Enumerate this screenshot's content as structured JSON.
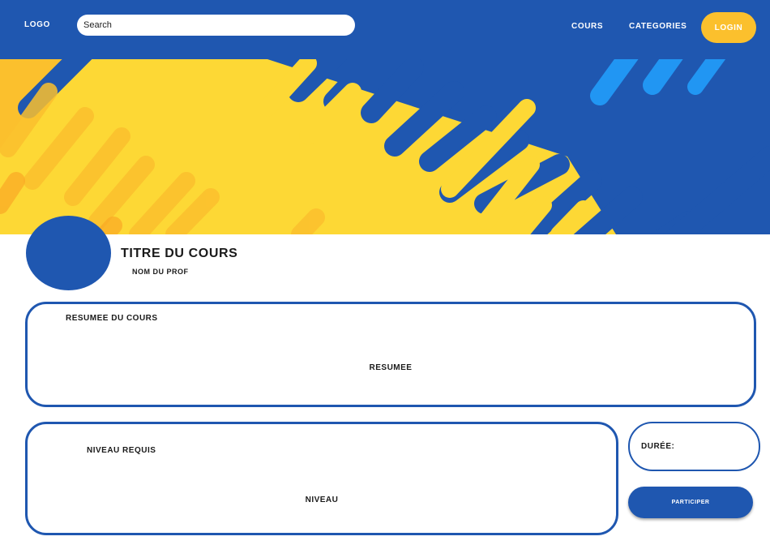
{
  "navbar": {
    "logo": "LOGO",
    "search_placeholder": "Search",
    "links": [
      "COURS",
      "CATEGORIES"
    ],
    "login_label": "LOGIN"
  },
  "course": {
    "title": "TITRE DU COURS",
    "professor": "NOM DU PROF"
  },
  "summary": {
    "heading": "RESUMEE DU COURS",
    "body": "RESUMEE"
  },
  "level": {
    "heading": "NIVEAU REQUIS",
    "body": "NIVEAU"
  },
  "duration": {
    "label": "DURÉE:"
  },
  "participate_label": "PARTICIPER",
  "colors": {
    "primary_blue": "#1f57b0",
    "accent_yellow": "#fbc02d",
    "banner_yellow": "#ffeb3b",
    "light_blue": "#2196f3"
  }
}
